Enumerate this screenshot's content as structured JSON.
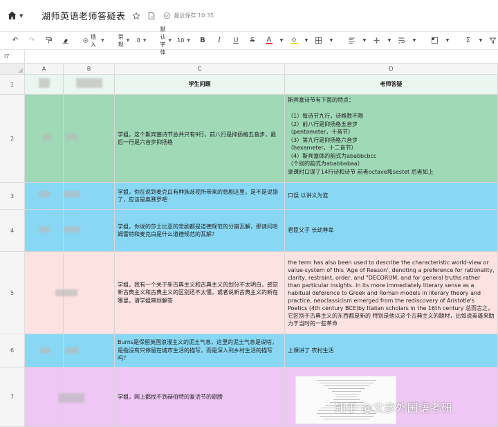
{
  "window": {
    "doc_title": "湖师英语老师答疑表",
    "saved_status": "最近保存 10:35"
  },
  "toolbar": {
    "insert_label": "插入",
    "format_label": "常规",
    "decimal_label": ".0",
    "font_label": "默认字体",
    "font_size_label": "10",
    "bold_label": "B",
    "italic_label": "I",
    "underline_label": "U",
    "strike_label": "S",
    "text_color_label": "A",
    "sum_label": "Σ"
  },
  "formula_bar": {
    "cell_ref": "I7"
  },
  "columns": [
    "A",
    "B",
    "C",
    "D"
  ],
  "rows": [
    "1",
    "2",
    "3",
    "4",
    "5",
    "6",
    "7"
  ],
  "header": {
    "question": "学生问题",
    "answer": "老师答疑"
  },
  "data_rows": [
    {
      "question": "学姐，这个斯宾塞诗节总共只有9行，前八行是抑扬格五音步，最后一行是六音步抑扬格",
      "answer": "斯宾塞诗节有下面的特点：\n\n（1）每诗节九行，诗格数不限\n（2）前八行是抑扬格五音步\n （pentameter，十音节）\n（3）第九行是抑扬格六音步\n （hexameter，十二音节）\n（4）斯宾塞体的韵式为ababbcbcc\n （个别的韵式为ababbabaa）\n录课时口误了14行诗和诗节 前者octave和sestet 后者如上",
      "color": "#9fd9b6"
    },
    {
      "question": "学姐，你在说到麦克白有种族歧视所带来的悲剧这里，是不是说错了，应该是奥赛罗吧",
      "answer": "口误 以讲义为准",
      "color": "#88d8f5"
    },
    {
      "question": "学姐，你说的莎士比亚的悲剧都是道德规范的分崩瓦解，那请问哈姆雷特和麦克白是什么道德规范的瓦解？",
      "answer": "君臣父子 长幼尊卑",
      "color": "#88d8f5"
    },
    {
      "question": "学姐，我有一个关于新古典主义和古典主义的划分不太明白，感觉新古典主义和古典主义的区别还不太懂，或者说新古典主义的新在哪里，请学姐麻烦解答",
      "answer": "the term has also been used to describe the characteristic world-view or value-system of this 'Age of Reason', denoting a preference for rationality, clarity, restraint, order, and \"DECORUM, and for general truths rather than particular insights. In its more immediately literary sense as a habitual deference to Greek and Roman models in literary theory and practice, neoclassicism emerged from the rediscovery of Aristotle's Poetics (4th century BCE)by Italian scholars in the 16th century 总而言之，它区别于古典主义的东西都是新的 特别是他以这个古典主义的题材，比如说英雄来助力于当时的一些革命",
      "color": "#fde2e2"
    },
    {
      "question": "Burns是保留英国浪漫主义的泥土气息，这里的泥土气息是说啥，是指没有只停留在城市生活的描写，而是深入到乡村生活的描写吗？",
      "answer": "上课讲了 农村生活",
      "color": "#88d8f5"
    },
    {
      "question": "学姐，网上都找不到赫伯特的复活节的翅膀",
      "answer": "",
      "color": "#efc7f5"
    }
  ],
  "watermark": "知乎 @文彦外国语考研"
}
